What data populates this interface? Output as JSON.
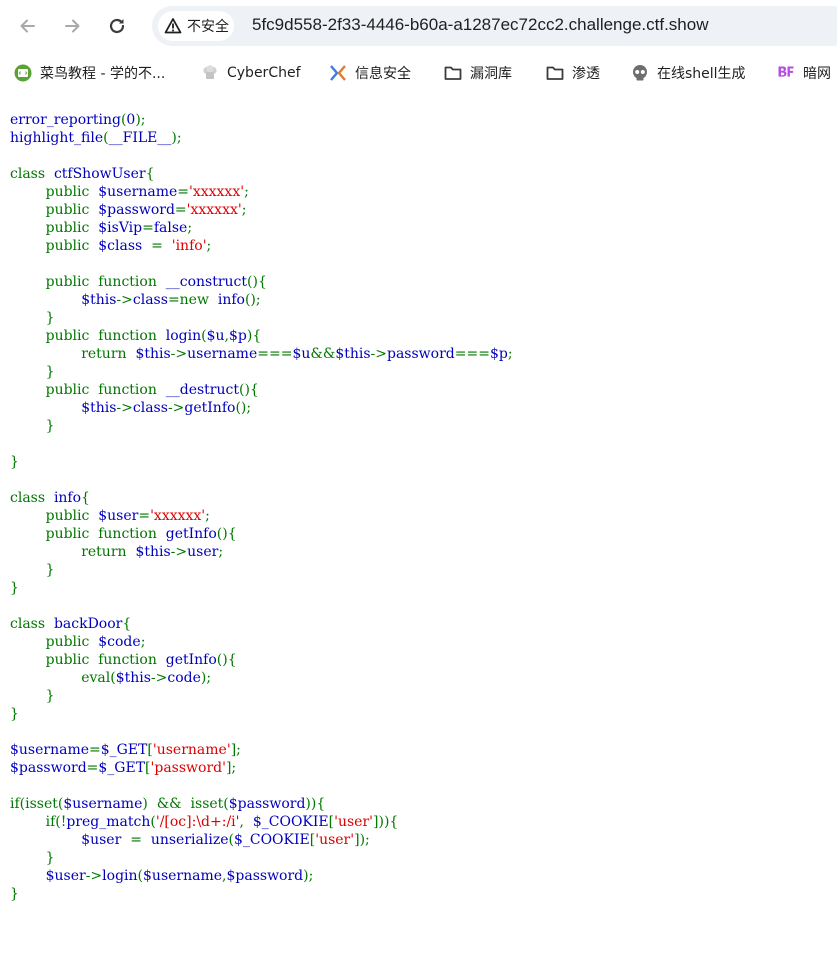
{
  "browser": {
    "security_label": "不安全",
    "url": "5fc9d558-2f33-4446-b60a-a1287ec72cc2.challenge.ctf.show",
    "icons": [
      "back-arrow-icon",
      "forward-arrow-icon",
      "reload-icon",
      "warning-triangle-icon"
    ]
  },
  "bookmarks": [
    {
      "label": "菜鸟教程 - 学的不...",
      "icon": "runoob-icon"
    },
    {
      "label": "CyberChef",
      "icon": "chef-hat-icon"
    },
    {
      "label": "信息安全",
      "icon": "ctf-logo-icon"
    },
    {
      "label": "漏洞库",
      "icon": "folder-icon"
    },
    {
      "label": "渗透",
      "icon": "folder-icon"
    },
    {
      "label": "在线shell生成",
      "icon": "skull-icon"
    },
    {
      "label": "暗网",
      "icon": "bf-logo-icon"
    }
  ],
  "colors": {
    "default": "#0000bb",
    "keyword": "#007700",
    "string": "#dd0000",
    "background": "#ffffff"
  },
  "code": [
    [
      [
        "d",
        "error_reporting"
      ],
      [
        "k",
        "("
      ],
      [
        "d",
        "0"
      ],
      [
        "k",
        ");"
      ]
    ],
    [
      [
        "d",
        "highlight_file"
      ],
      [
        "k",
        "("
      ],
      [
        "d",
        "__FILE__"
      ],
      [
        "k",
        ");"
      ]
    ],
    [],
    [
      [
        "k",
        "class  "
      ],
      [
        "d",
        "ctfShowUser"
      ],
      [
        "k",
        "{"
      ]
    ],
    [
      [
        "k",
        "        public  "
      ],
      [
        "d",
        "$username"
      ],
      [
        "k",
        "="
      ],
      [
        "s",
        "'xxxxxx'"
      ],
      [
        "k",
        ";"
      ]
    ],
    [
      [
        "k",
        "        public  "
      ],
      [
        "d",
        "$password"
      ],
      [
        "k",
        "="
      ],
      [
        "s",
        "'xxxxxx'"
      ],
      [
        "k",
        ";"
      ]
    ],
    [
      [
        "k",
        "        public  "
      ],
      [
        "d",
        "$isVip"
      ],
      [
        "k",
        "="
      ],
      [
        "d",
        "false"
      ],
      [
        "k",
        ";"
      ]
    ],
    [
      [
        "k",
        "        public  "
      ],
      [
        "d",
        "$class  "
      ],
      [
        "k",
        "=  "
      ],
      [
        "s",
        "'info'"
      ],
      [
        "k",
        ";"
      ]
    ],
    [],
    [
      [
        "k",
        "        public  function  "
      ],
      [
        "d",
        "__construct"
      ],
      [
        "k",
        "(){"
      ]
    ],
    [
      [
        "k",
        "                "
      ],
      [
        "d",
        "$this"
      ],
      [
        "k",
        "->"
      ],
      [
        "d",
        "class"
      ],
      [
        "k",
        "=new  "
      ],
      [
        "d",
        "info"
      ],
      [
        "k",
        "();"
      ]
    ],
    [
      [
        "k",
        "        }"
      ]
    ],
    [
      [
        "k",
        "        public  function  "
      ],
      [
        "d",
        "login"
      ],
      [
        "k",
        "("
      ],
      [
        "d",
        "$u"
      ],
      [
        "k",
        ","
      ],
      [
        "d",
        "$p"
      ],
      [
        "k",
        "){"
      ]
    ],
    [
      [
        "k",
        "                return  "
      ],
      [
        "d",
        "$this"
      ],
      [
        "k",
        "->"
      ],
      [
        "d",
        "username"
      ],
      [
        "k",
        "==="
      ],
      [
        "d",
        "$u"
      ],
      [
        "k",
        "&&"
      ],
      [
        "d",
        "$this"
      ],
      [
        "k",
        "->"
      ],
      [
        "d",
        "password"
      ],
      [
        "k",
        "==="
      ],
      [
        "d",
        "$p"
      ],
      [
        "k",
        ";"
      ]
    ],
    [
      [
        "k",
        "        }"
      ]
    ],
    [
      [
        "k",
        "        public  function  "
      ],
      [
        "d",
        "__destruct"
      ],
      [
        "k",
        "(){"
      ]
    ],
    [
      [
        "k",
        "                "
      ],
      [
        "d",
        "$this"
      ],
      [
        "k",
        "->"
      ],
      [
        "d",
        "class"
      ],
      [
        "k",
        "->"
      ],
      [
        "d",
        "getInfo"
      ],
      [
        "k",
        "();"
      ]
    ],
    [
      [
        "k",
        "        }"
      ]
    ],
    [],
    [
      [
        "k",
        "}"
      ]
    ],
    [],
    [
      [
        "k",
        "class  "
      ],
      [
        "d",
        "info"
      ],
      [
        "k",
        "{"
      ]
    ],
    [
      [
        "k",
        "        public  "
      ],
      [
        "d",
        "$user"
      ],
      [
        "k",
        "="
      ],
      [
        "s",
        "'xxxxxx'"
      ],
      [
        "k",
        ";"
      ]
    ],
    [
      [
        "k",
        "        public  function  "
      ],
      [
        "d",
        "getInfo"
      ],
      [
        "k",
        "(){"
      ]
    ],
    [
      [
        "k",
        "                return  "
      ],
      [
        "d",
        "$this"
      ],
      [
        "k",
        "->"
      ],
      [
        "d",
        "user"
      ],
      [
        "k",
        ";"
      ]
    ],
    [
      [
        "k",
        "        }"
      ]
    ],
    [
      [
        "k",
        "}"
      ]
    ],
    [],
    [
      [
        "k",
        "class  "
      ],
      [
        "d",
        "backDoor"
      ],
      [
        "k",
        "{"
      ]
    ],
    [
      [
        "k",
        "        public  "
      ],
      [
        "d",
        "$code"
      ],
      [
        "k",
        ";"
      ]
    ],
    [
      [
        "k",
        "        public  function  "
      ],
      [
        "d",
        "getInfo"
      ],
      [
        "k",
        "(){"
      ]
    ],
    [
      [
        "k",
        "                eval("
      ],
      [
        "d",
        "$this"
      ],
      [
        "k",
        "->"
      ],
      [
        "d",
        "code"
      ],
      [
        "k",
        ");"
      ]
    ],
    [
      [
        "k",
        "        }"
      ]
    ],
    [
      [
        "k",
        "}"
      ]
    ],
    [],
    [
      [
        "d",
        "$username"
      ],
      [
        "k",
        "="
      ],
      [
        "d",
        "$_GET"
      ],
      [
        "k",
        "["
      ],
      [
        "s",
        "'username'"
      ],
      [
        "k",
        "];"
      ]
    ],
    [
      [
        "d",
        "$password"
      ],
      [
        "k",
        "="
      ],
      [
        "d",
        "$_GET"
      ],
      [
        "k",
        "["
      ],
      [
        "s",
        "'password'"
      ],
      [
        "k",
        "];"
      ]
    ],
    [],
    [
      [
        "k",
        "if(isset("
      ],
      [
        "d",
        "$username"
      ],
      [
        "k",
        ")  &&  isset("
      ],
      [
        "d",
        "$password"
      ],
      [
        "k",
        ")){"
      ]
    ],
    [
      [
        "k",
        "        if(!"
      ],
      [
        "d",
        "preg_match"
      ],
      [
        "k",
        "("
      ],
      [
        "s",
        "'/[oc]:\\d+:/i'"
      ],
      [
        "k",
        ",  "
      ],
      [
        "d",
        "$_COOKIE"
      ],
      [
        "k",
        "["
      ],
      [
        "s",
        "'user'"
      ],
      [
        "k",
        "])){"
      ]
    ],
    [
      [
        "k",
        "                "
      ],
      [
        "d",
        "$user  "
      ],
      [
        "k",
        "=  "
      ],
      [
        "d",
        "unserialize"
      ],
      [
        "k",
        "("
      ],
      [
        "d",
        "$_COOKIE"
      ],
      [
        "k",
        "["
      ],
      [
        "s",
        "'user'"
      ],
      [
        "k",
        "]);"
      ]
    ],
    [
      [
        "k",
        "        }"
      ]
    ],
    [
      [
        "k",
        "        "
      ],
      [
        "d",
        "$user"
      ],
      [
        "k",
        "->"
      ],
      [
        "d",
        "login"
      ],
      [
        "k",
        "("
      ],
      [
        "d",
        "$username"
      ],
      [
        "k",
        ","
      ],
      [
        "d",
        "$password"
      ],
      [
        "k",
        ");"
      ]
    ],
    [
      [
        "k",
        "}"
      ]
    ]
  ]
}
